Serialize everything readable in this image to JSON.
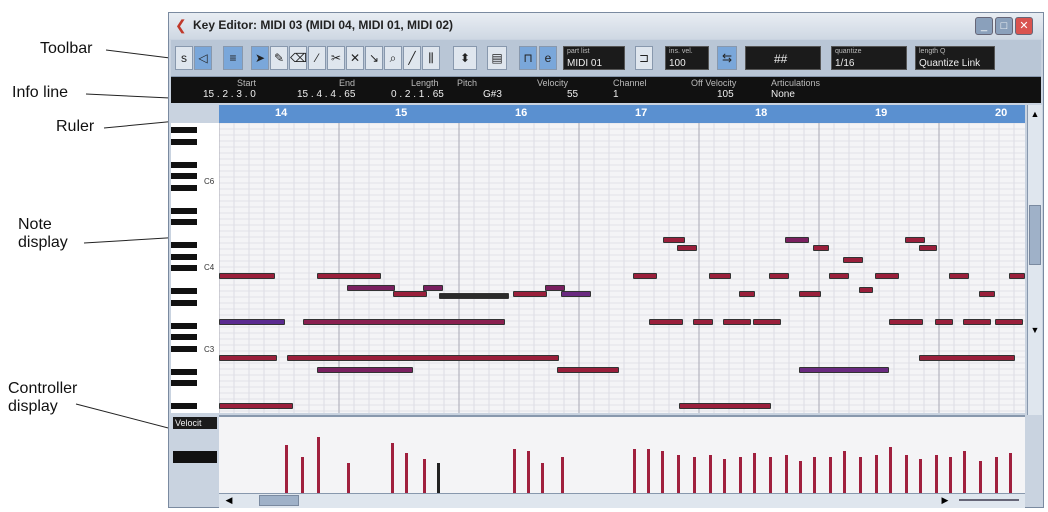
{
  "callouts": {
    "toolbar": "Toolbar",
    "info_line": "Info line",
    "ruler": "Ruler",
    "note_display": "Note\ndisplay",
    "controller_display": "Controller\ndisplay"
  },
  "window": {
    "title": "Key Editor: MIDI 03 (MIDI 04, MIDI 01, MIDI 02)",
    "minimize_glyph": "_",
    "maximize_glyph": "□",
    "close_glyph": "✕"
  },
  "toolbar": {
    "part_list_label": "part list",
    "part_list_value": "MIDI 01",
    "ins_vel_label": "ins. vel.",
    "ins_vel_value": "100",
    "grid_value": "##",
    "quantize_label": "quantize",
    "quantize_value": "1/16",
    "length_q_label": "length Q",
    "length_q_value": "Quantize Link"
  },
  "info_line": {
    "headers": [
      "Start",
      "End",
      "Length",
      "Pitch",
      "Velocity",
      "Channel",
      "Off Velocity",
      "Articulations"
    ],
    "values": [
      "15 . 2 . 3 .   0",
      "15 . 4 . 4 . 65",
      "0 . 2 . 1 . 65",
      "G#3",
      "55",
      "1",
      "105",
      "None"
    ]
  },
  "ruler": {
    "bars": [
      "14",
      "15",
      "16",
      "17",
      "18",
      "19",
      "20"
    ]
  },
  "keyboard": {
    "labels": [
      "C6",
      "C4",
      "C3"
    ]
  },
  "controller": {
    "lane_name": "Velocit"
  },
  "colors": {
    "note_primary": "#9a1f3b",
    "note_alt": "#6a2a80",
    "ruler": "#5a90d0"
  }
}
